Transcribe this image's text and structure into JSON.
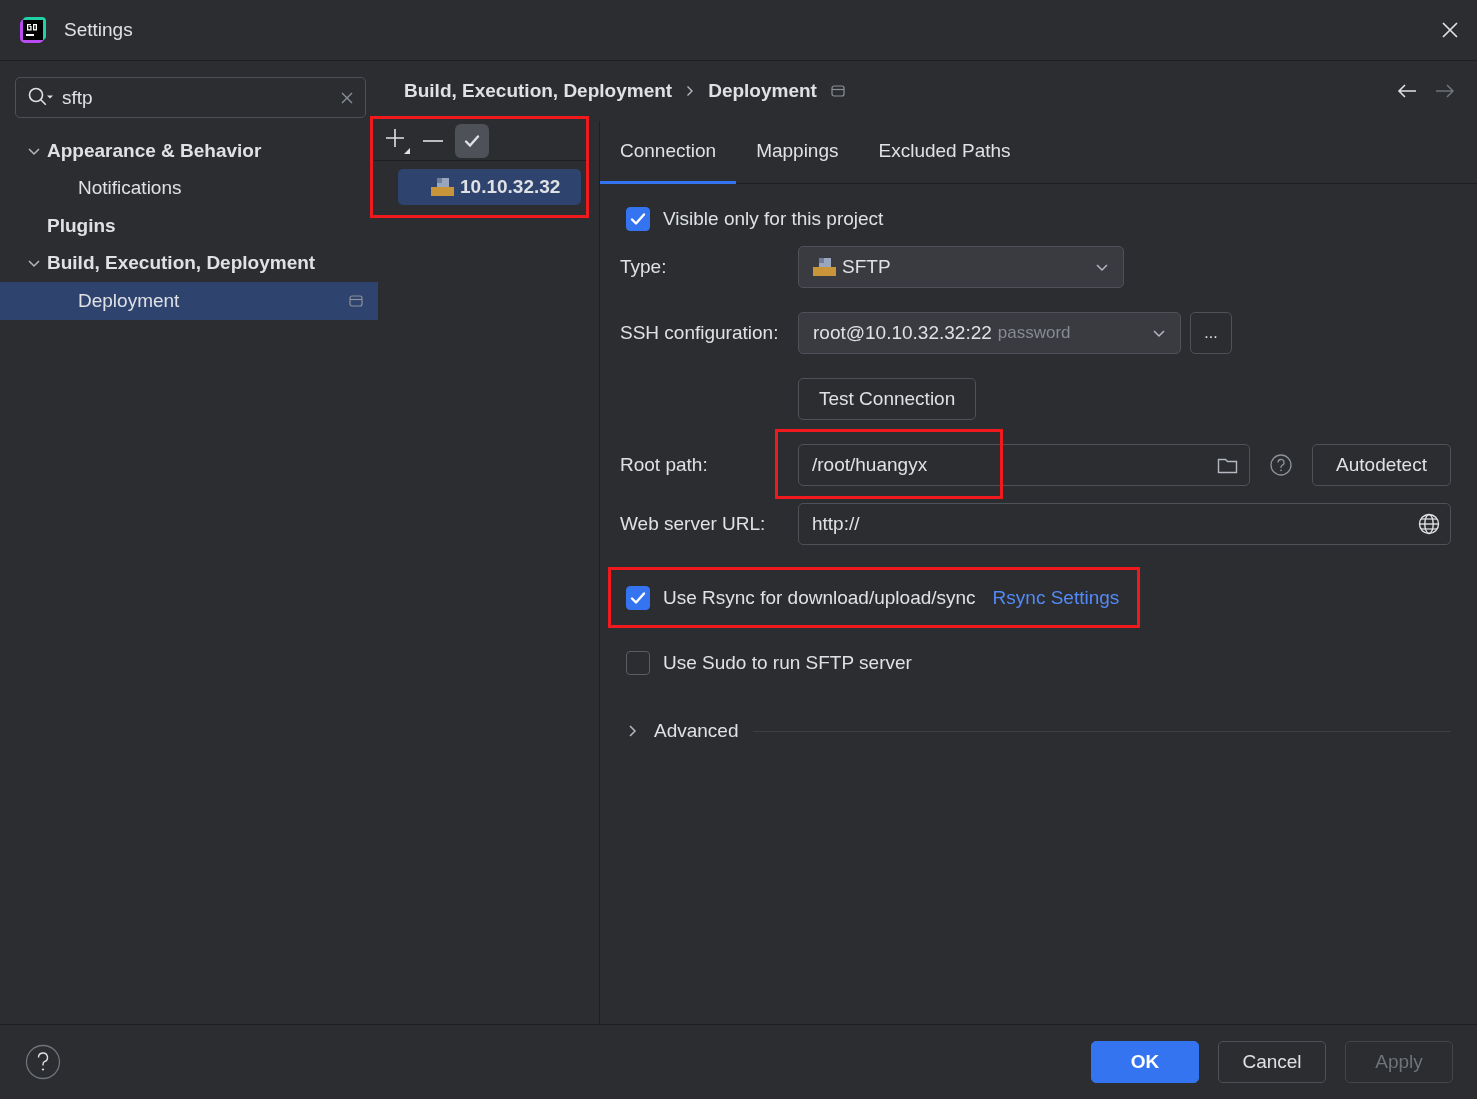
{
  "window": {
    "title": "Settings"
  },
  "search": {
    "value": "sftp"
  },
  "sidebar": {
    "items": [
      {
        "label": "Appearance & Behavior",
        "expanded": true,
        "selected": false,
        "children": [
          {
            "label": "Notifications",
            "selected": false
          }
        ]
      },
      {
        "label": "Plugins",
        "selected": false
      },
      {
        "label": "Build, Execution, Deployment",
        "expanded": true,
        "selected": false,
        "children": [
          {
            "label": "Deployment",
            "selected": true
          }
        ]
      }
    ]
  },
  "breadcrumb": [
    "Build, Execution, Deployment",
    "Deployment"
  ],
  "servers": {
    "highlighted": true,
    "items": [
      {
        "label": "10.10.32.32",
        "selected": true
      }
    ]
  },
  "tabs": [
    {
      "label": "Connection",
      "selected": true
    },
    {
      "label": "Mappings",
      "selected": false
    },
    {
      "label": "Excluded Paths",
      "selected": false
    }
  ],
  "form": {
    "visible_only": {
      "label": "Visible only for this project",
      "checked": true
    },
    "type": {
      "label": "Type:",
      "value": "SFTP"
    },
    "ssh": {
      "label": "SSH configuration:",
      "value": "root@10.10.32.32:22",
      "hint": "password",
      "more": "..."
    },
    "test_button": "Test Connection",
    "root_path": {
      "label": "Root path:",
      "value": "/root/huangyx",
      "highlighted": true,
      "action": "Autodetect"
    },
    "web_url": {
      "label": "Web server URL:",
      "value": "http://"
    },
    "rsync": {
      "label": "Use Rsync for download/upload/sync",
      "checked": true,
      "link": "Rsync Settings",
      "highlighted": true
    },
    "sudo": {
      "label": "Use Sudo to run SFTP server",
      "checked": false
    },
    "advanced": {
      "label": "Advanced",
      "expanded": false
    }
  },
  "buttons": [
    {
      "label": "OK",
      "kind": "primary",
      "disabled": false
    },
    {
      "label": "Cancel",
      "kind": "normal",
      "disabled": false
    },
    {
      "label": "Apply",
      "kind": "normal",
      "disabled": true
    }
  ]
}
